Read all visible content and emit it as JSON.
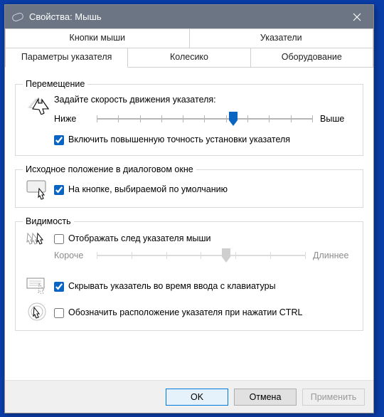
{
  "window": {
    "title": "Свойства: Мышь"
  },
  "tabs": {
    "row1": [
      "Кнопки мыши",
      "Указатели"
    ],
    "row2": [
      "Параметры указателя",
      "Колесико",
      "Оборудование"
    ],
    "active": "Параметры указателя"
  },
  "groups": {
    "motion": {
      "legend": "Перемещение",
      "heading": "Задайте скорость движения указателя:",
      "slow": "Ниже",
      "fast": "Выше",
      "enhance": {
        "label": "Включить повышенную точность установки указателя",
        "checked": true
      }
    },
    "snap": {
      "legend": "Исходное положение в диалоговом окне",
      "opt": {
        "label": "На кнопке, выбираемой по умолчанию",
        "checked": true
      }
    },
    "visibility": {
      "legend": "Видимость",
      "trails": {
        "label": "Отображать след указателя мыши",
        "checked": false,
        "short": "Короче",
        "long": "Длиннее"
      },
      "hide": {
        "label": "Скрывать указатель во время ввода с клавиатуры",
        "checked": true
      },
      "ctrl": {
        "label": "Обозначить расположение указателя при нажатии CTRL",
        "checked": false
      }
    }
  },
  "buttons": {
    "ok": "OK",
    "cancel": "Отмена",
    "apply": "Применить"
  }
}
